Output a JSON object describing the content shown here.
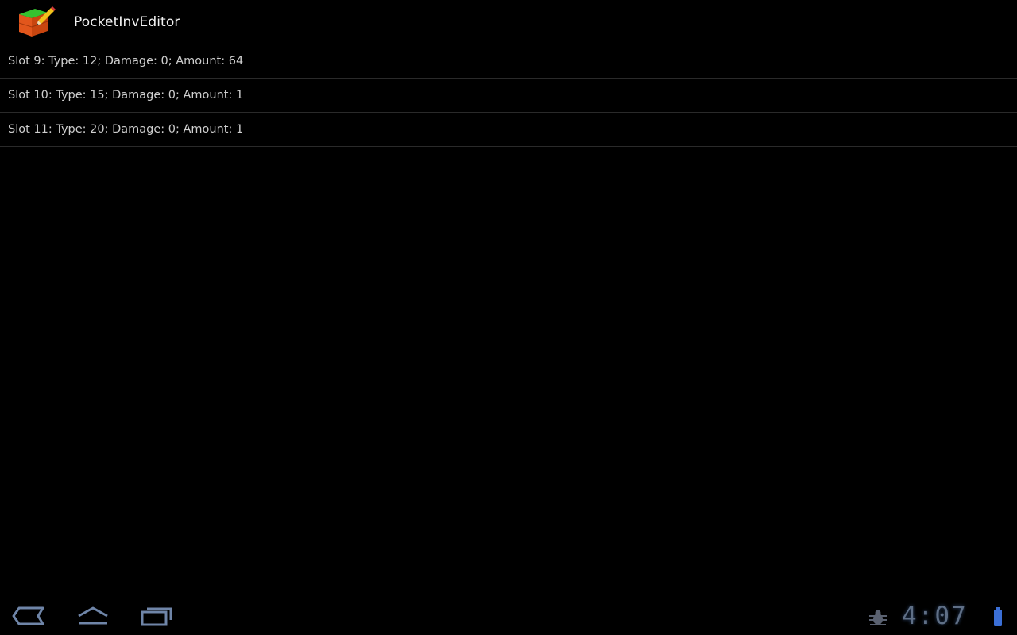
{
  "app": {
    "title": "PocketInvEditor",
    "icon": "cube-edit-icon"
  },
  "inventory": {
    "items": [
      {
        "label": "Slot 9: Type: 12; Damage: 0; Amount: 64"
      },
      {
        "label": "Slot 10: Type: 15; Damage: 0; Amount: 1"
      },
      {
        "label": "Slot 11: Type: 20; Damage: 0; Amount: 1"
      }
    ]
  },
  "system_bar": {
    "time": "4:07",
    "icons": [
      "back-icon",
      "home-icon",
      "recents-icon",
      "debug-icon",
      "battery-icon"
    ]
  },
  "colors": {
    "background": "#000000",
    "title_text": "#f2f2f2",
    "list_text": "#cfcfcf",
    "divider": "#2a2a2a",
    "system_accent": "#5f6f86",
    "battery": "#3b6fd6"
  }
}
